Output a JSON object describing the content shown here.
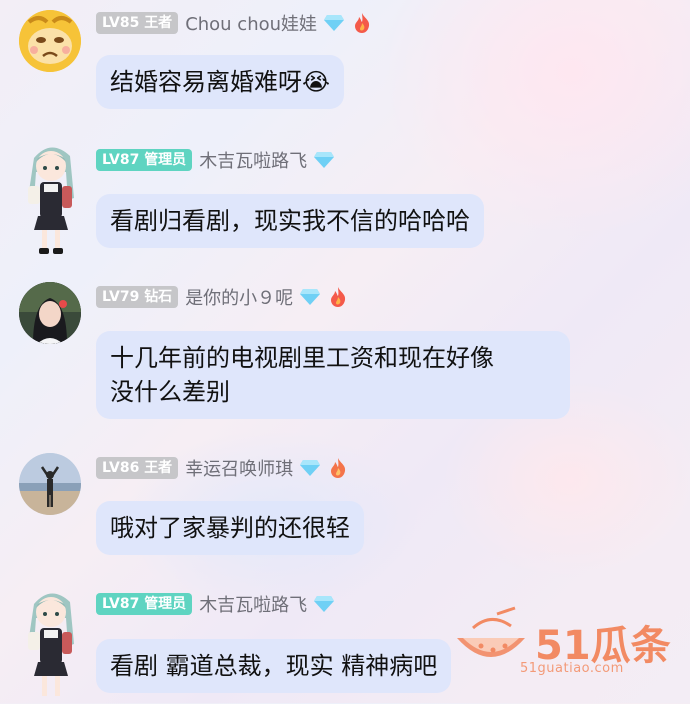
{
  "messages": [
    {
      "level": "LV85",
      "role": "王者",
      "username": "Chou chou娃娃",
      "gem_icon": "diamond-icon",
      "flame_icon": "flame-icon",
      "text": "结婚容易离婚难呀😭"
    },
    {
      "level": "LV87",
      "role": "管理员",
      "username": "木吉瓦啦路飞",
      "gem_icon": "diamond-icon",
      "text": "看剧归看剧，现实我不信的哈哈哈"
    },
    {
      "level": "LV79",
      "role": "钻石",
      "username": "是你的小９呢",
      "gem_icon": "diamond-icon",
      "flame_icon": "flame-icon",
      "text_line1": "十几年前的电视剧里工资和现在好像",
      "text_line2": "没什么差别"
    },
    {
      "level": "LV86",
      "role": "王者",
      "username": "幸运召唤师琪",
      "gem_icon": "diamond-icon",
      "flame_icon": "flame-icon",
      "text": "哦对了家暴判的还很轻"
    },
    {
      "level": "LV87",
      "role": "管理员",
      "username": "木吉瓦啦路飞",
      "gem_icon": "diamond-icon",
      "text": "看剧 霸道总裁，现实 精神病吧"
    }
  ],
  "watermark": {
    "name": "51瓜条",
    "url": "51guatiao.com",
    "icon": "watermelon-logo"
  },
  "colors": {
    "bubble": "#dfe6fb",
    "badge_gray": "#c6c6c9",
    "badge_teal": "#5fd4c1",
    "username": "#6f6f78",
    "watermark": "#f28a63"
  }
}
